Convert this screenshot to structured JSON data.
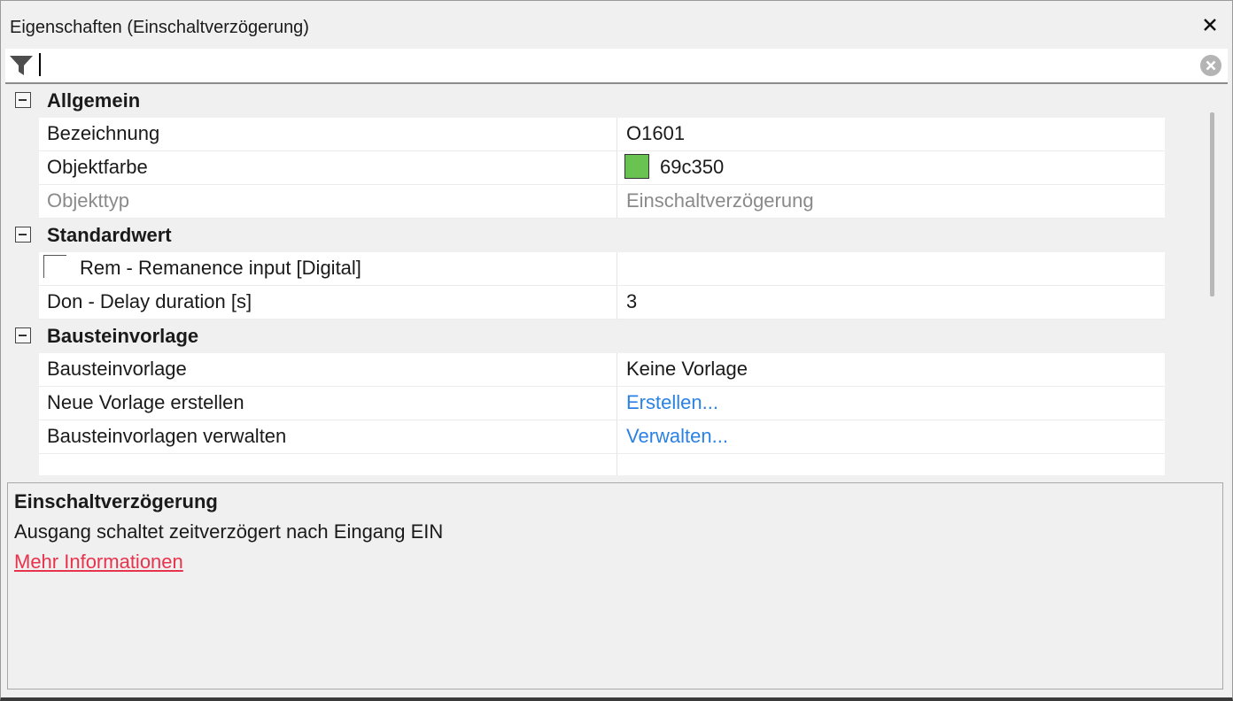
{
  "window": {
    "title": "Eigenschaften (Einschaltverzögerung)",
    "close_icon": "close-icon"
  },
  "filter": {
    "value": "",
    "filter_icon": "filter-icon",
    "clear_icon": "clear-icon"
  },
  "categories": {
    "allgemein": {
      "label": "Allgemein",
      "rows": [
        {
          "name": "Bezeichnung",
          "value": "O1601"
        },
        {
          "name": "Objektfarbe",
          "value": "69c350",
          "color": "#69c350"
        },
        {
          "name": "Objekttyp",
          "value": "Einschaltverzögerung",
          "disabled": true
        }
      ]
    },
    "standardwert": {
      "label": "Standardwert",
      "rows": [
        {
          "name": "Rem - Remanence input [Digital]",
          "checked": false,
          "value": ""
        },
        {
          "name": "Don - Delay duration [s]",
          "value": "3"
        }
      ]
    },
    "bausteinvorlage": {
      "label": "Bausteinvorlage",
      "rows": [
        {
          "name": "Bausteinvorlage",
          "value": "Keine Vorlage"
        },
        {
          "name": "Neue Vorlage erstellen",
          "value": "Erstellen..."
        },
        {
          "name": "Bausteinvorlagen verwalten",
          "value": "Verwalten..."
        }
      ]
    }
  },
  "description": {
    "title": "Einschaltverzögerung",
    "text": "Ausgang schaltet zeitverzögert nach Eingang EIN",
    "link": "Mehr Informationen"
  },
  "colors": {
    "link": "#2a82e4",
    "more_info_link": "#e8334d",
    "object_color": "#69c350"
  }
}
